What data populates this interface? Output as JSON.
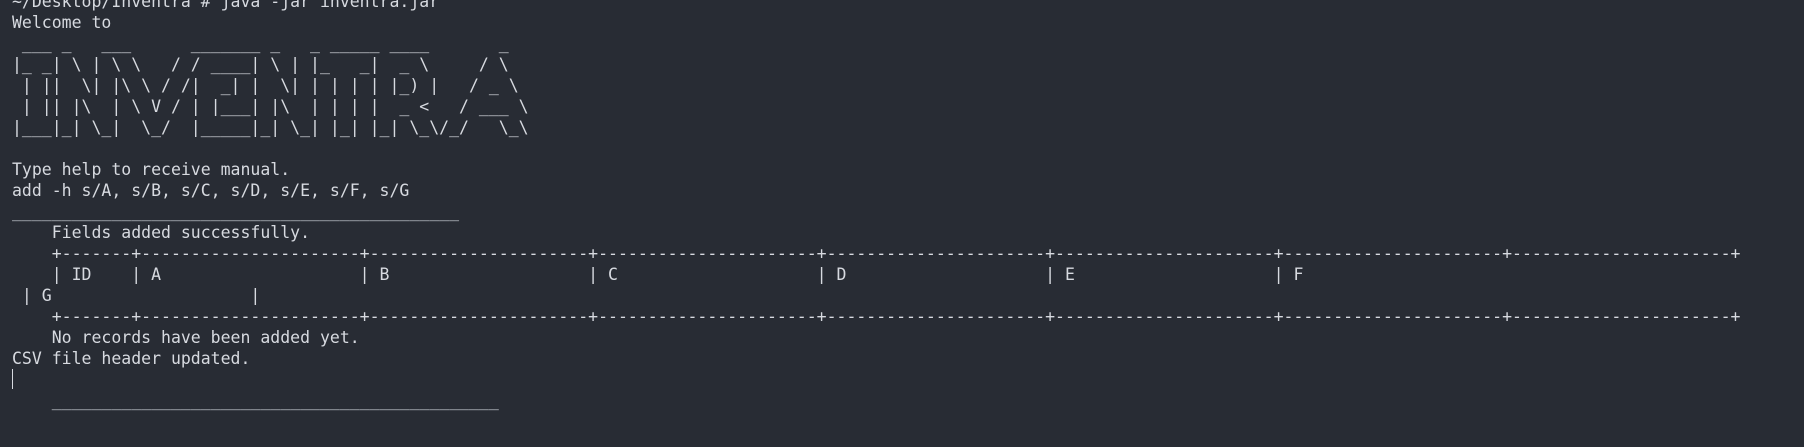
{
  "terminal": {
    "prompt_line": "~/Desktop/Inventra # java -jar inventra.jar",
    "welcome": "Welcome to",
    "banner": [
      " ___ _   ___      _______ _   _ _____ ____       _",
      "|_ _| \\ | \\ \\   / / ____| \\ | |_   _|  _ \\     / \\",
      " | ||  \\| |\\ \\ / /|  _| |  \\| | | | | |_) |   / _ \\",
      " | || |\\  | \\ V / | |___| |\\  | | | |  _ <   / ___ \\",
      "|___|_| \\_|  \\_/  |_____|_| \\_| |_| |_| \\_\\/_/   \\_\\"
    ],
    "help_hint": "Type help to receive manual.",
    "command": "add -h s/A, s/B, s/C, s/D, s/E, s/F, s/G",
    "separator": "_____________________________________________",
    "success_msg": "    Fields added successfully.",
    "table_border": "    +-------+----------------------+----------------------+----------------------+----------------------+----------------------+----------------------+----------------------+",
    "table_header": "    | ID    | A                    | B                    | C                    | D                    | E                    | F",
    "table_header_wrap": " | G                    |",
    "no_records": "    No records have been added yet.",
    "csv_msg": "CSV file header updated.",
    "final_separator": "_____________________________________________"
  }
}
